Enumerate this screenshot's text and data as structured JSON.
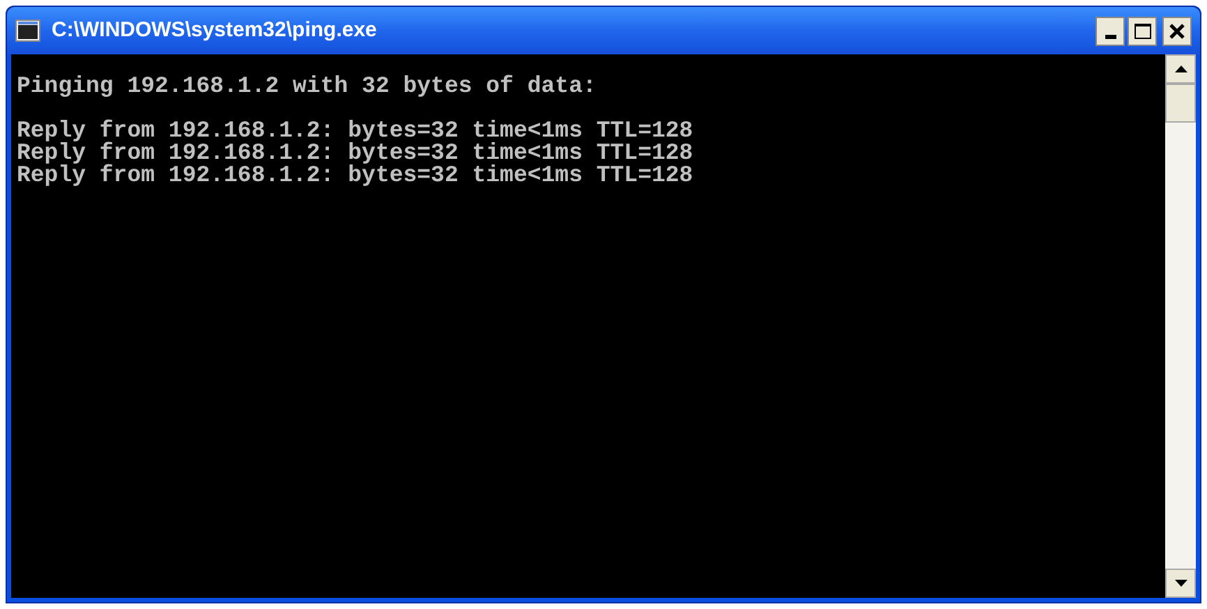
{
  "window": {
    "title": "C:\\WINDOWS\\system32\\ping.exe"
  },
  "console": {
    "header": "Pinging 192.168.1.2 with 32 bytes of data:",
    "replies": [
      "Reply from 192.168.1.2: bytes=32 time<1ms TTL=128",
      "Reply from 192.168.1.2: bytes=32 time<1ms TTL=128",
      "Reply from 192.168.1.2: bytes=32 time<1ms TTL=128"
    ]
  }
}
